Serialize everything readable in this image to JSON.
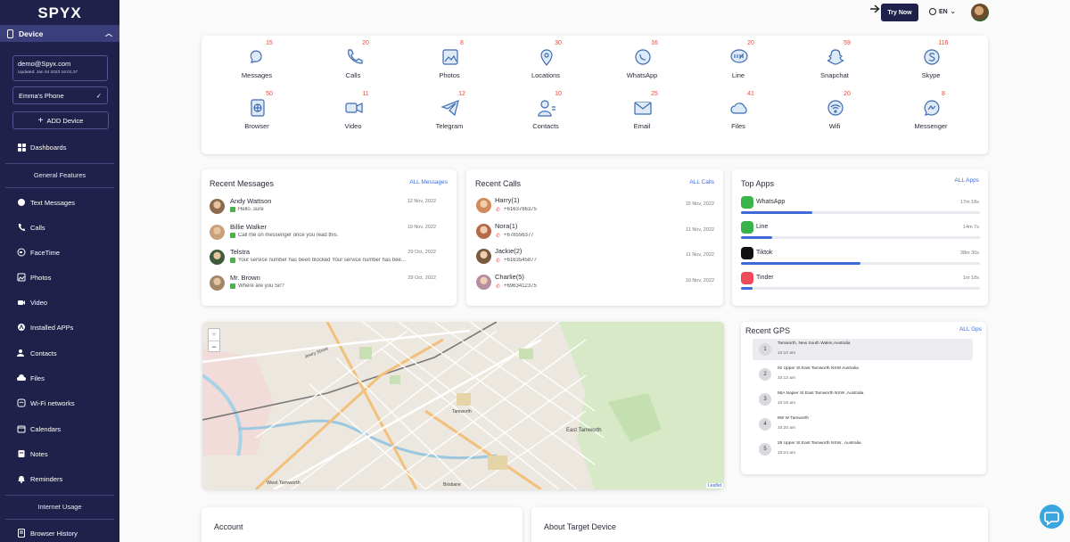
{
  "brand": "SPYX",
  "sidebar": {
    "device_label": "Device",
    "account_email": "demo@Spyx.com",
    "account_updated": "Updated: Jan 04 2023 16:01:37",
    "phone_name": "Emma's Phone",
    "add_device": "ADD Device",
    "dashboards": "Dashboards",
    "general_features": "General Features",
    "items": [
      {
        "label": "Text Messages",
        "icon": "chat-icon"
      },
      {
        "label": "Calls",
        "icon": "phone-icon"
      },
      {
        "label": "FaceTime",
        "icon": "facetime-icon"
      },
      {
        "label": "Photos",
        "icon": "image-icon"
      },
      {
        "label": "Video",
        "icon": "video-icon"
      },
      {
        "label": "Installed APPs",
        "icon": "apps-icon"
      },
      {
        "label": "Contacts",
        "icon": "contacts-icon"
      },
      {
        "label": "Files",
        "icon": "cloud-icon"
      },
      {
        "label": "Wi-Fi networks",
        "icon": "wifi-icon"
      },
      {
        "label": "Calendars",
        "icon": "calendar-icon"
      },
      {
        "label": "Notes",
        "icon": "notes-icon"
      },
      {
        "label": "Reminders",
        "icon": "bell-icon"
      }
    ],
    "internet_usage": "Internet Usage",
    "browser_history": "Browser History"
  },
  "header": {
    "try_now": "Try Now",
    "language": "EN"
  },
  "features": [
    {
      "label": "Messages",
      "count": "15",
      "icon": "messages-icon"
    },
    {
      "label": "Calls",
      "count": "20",
      "icon": "calls-icon"
    },
    {
      "label": "Photos",
      "count": "8",
      "icon": "photos-icon"
    },
    {
      "label": "Locations",
      "count": "30",
      "icon": "location-pin-icon"
    },
    {
      "label": "WhatsApp",
      "count": "16",
      "icon": "whatsapp-icon"
    },
    {
      "label": "Line",
      "count": "20",
      "icon": "line-icon"
    },
    {
      "label": "Snapchat",
      "count": "59",
      "icon": "snapchat-icon"
    },
    {
      "label": "Skype",
      "count": "116",
      "icon": "skype-icon"
    },
    {
      "label": "Browser",
      "count": "50",
      "icon": "browser-icon"
    },
    {
      "label": "Video",
      "count": "11",
      "icon": "video-camera-icon"
    },
    {
      "label": "Telegram",
      "count": "12",
      "icon": "telegram-icon"
    },
    {
      "label": "Contacts",
      "count": "10",
      "icon": "contacts-icon"
    },
    {
      "label": "Email",
      "count": "25",
      "icon": "email-icon"
    },
    {
      "label": "Files",
      "count": "41",
      "icon": "files-cloud-icon"
    },
    {
      "label": "Wifi",
      "count": "20",
      "icon": "wifi-icon"
    },
    {
      "label": "Messenger",
      "count": "8",
      "icon": "messenger-icon"
    }
  ],
  "recent_messages": {
    "title": "Recent Messages",
    "link": "ALL Messages",
    "items": [
      {
        "name": "Andy Wattson",
        "text": "Hello..sure",
        "date": "12 Nov, 2022"
      },
      {
        "name": "Billie Walker",
        "text": "Call me on messenger once you read this.",
        "date": "19 Nov, 2022"
      },
      {
        "name": "Telstra",
        "text": "Your service number has been blocked Your service number has bee...",
        "date": "29 Oct, 2022"
      },
      {
        "name": "Mr. Brown",
        "text": "Where are you Sir?",
        "date": "29 Oct, 2022"
      }
    ]
  },
  "recent_calls": {
    "title": "Recent Calls",
    "link": "ALL Calls",
    "items": [
      {
        "name": "Harry(1)",
        "number": "+6163786375",
        "date": "15 Nov, 2022"
      },
      {
        "name": "Nora(1)",
        "number": "+678556377",
        "date": "11 Nov, 2022"
      },
      {
        "name": "Jackie(2)",
        "number": "+6163545877",
        "date": "11 Nov, 2022"
      },
      {
        "name": "Charlie(5)",
        "number": "+6963412375",
        "date": "10 Nov, 2022"
      }
    ]
  },
  "top_apps": {
    "title": "Top Apps",
    "link": "ALL Apps",
    "items": [
      {
        "name": "WhatsApp",
        "time": "17m 18s",
        "fraction": 0.3,
        "color": "#3bb54a"
      },
      {
        "name": "Line",
        "time": "14m 7s",
        "fraction": 0.13,
        "color": "#37b34a"
      },
      {
        "name": "Tiktok",
        "time": "38m 30s",
        "fraction": 0.5,
        "color": "#111111"
      },
      {
        "name": "Tinder",
        "time": "1m 18s",
        "fraction": 0.05,
        "color": "#ef4b5a"
      }
    ]
  },
  "map": {
    "labels": [
      "Jewry Street",
      "Tamworth",
      "East Tamworth",
      "West Tamworth",
      "Brisbane"
    ],
    "zoom_in": "+",
    "zoom_out": "−",
    "attribution": "Leaflet"
  },
  "recent_gps": {
    "title": "Recent GPS",
    "link": "ALL Gps",
    "items": [
      {
        "n": "1",
        "addr": "Tamworth, New South Wales,Australia",
        "time": "10:10 am"
      },
      {
        "n": "2",
        "addr": "92 Upper St East Tamworth NSW Australia",
        "time": "10:12 am"
      },
      {
        "n": "3",
        "addr": "56A Napier St East Tamworth NSW ,Australia",
        "time": "10:15 am"
      },
      {
        "n": "4",
        "addr": "8W W Tamworth",
        "time": "10:20 am"
      },
      {
        "n": "5",
        "addr": "29 Upper St East Tamworth NSW , Australia",
        "time": "10:24 am"
      }
    ]
  },
  "bottom": {
    "account": "Account",
    "about": "About Target Device"
  }
}
